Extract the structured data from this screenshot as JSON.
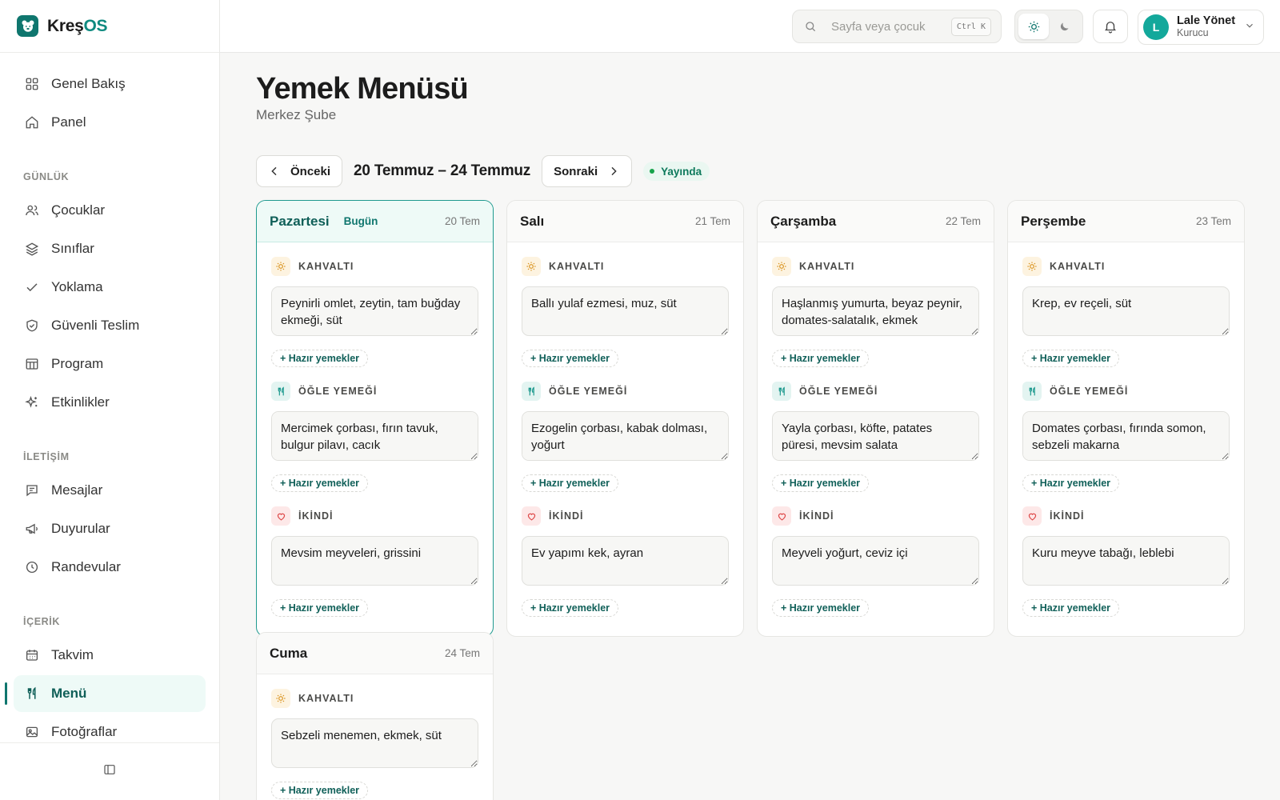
{
  "brand": {
    "name_part1": "Kreş",
    "name_part2": "OS"
  },
  "sidebar": {
    "top": [
      {
        "label": "Genel Bakış",
        "icon": "grid-icon"
      },
      {
        "label": "Panel",
        "icon": "home-icon"
      }
    ],
    "sections": [
      {
        "title": "GÜNLÜK",
        "items": [
          {
            "label": "Çocuklar",
            "icon": "users-icon"
          },
          {
            "label": "Sınıflar",
            "icon": "layers-icon"
          },
          {
            "label": "Yoklama",
            "icon": "check-icon"
          },
          {
            "label": "Güvenli Teslim",
            "icon": "shield-check-icon"
          },
          {
            "label": "Program",
            "icon": "table-icon"
          },
          {
            "label": "Etkinlikler",
            "icon": "sparkle-icon"
          }
        ]
      },
      {
        "title": "İLETİŞİM",
        "items": [
          {
            "label": "Mesajlar",
            "icon": "message-icon"
          },
          {
            "label": "Duyurular",
            "icon": "megaphone-icon"
          },
          {
            "label": "Randevular",
            "icon": "clock-icon"
          }
        ]
      },
      {
        "title": "İÇERİK",
        "items": [
          {
            "label": "Takvim",
            "icon": "calendar-icon"
          },
          {
            "label": "Menü",
            "icon": "fork-knife-icon",
            "active": true
          },
          {
            "label": "Fotoğraflar",
            "icon": "image-icon"
          }
        ]
      }
    ]
  },
  "topbar": {
    "search_placeholder": "Sayfa veya çocuk",
    "search_shortcut": "Ctrl K",
    "user_initial": "L",
    "user_name": "Lale Yönet",
    "user_role": "Kurucu"
  },
  "page": {
    "title": "Yemek Menüsü",
    "subtitle": "Merkez Şube",
    "prev_label": "Önceki",
    "next_label": "Sonraki",
    "week_range": "20 Temmuz – 24 Temmuz",
    "status": "Yayında"
  },
  "meal_labels": {
    "breakfast": "KAHVALTI",
    "lunch": "ÖĞLE YEMEĞİ",
    "snack": "İKİNDİ"
  },
  "preset_label": "+ Hazır yemekler",
  "today_label": "Bugün",
  "days": [
    {
      "name": "Pazartesi",
      "date": "20 Tem",
      "today": true,
      "breakfast": "Peynirli omlet, zeytin, tam buğday ekmeği, süt",
      "lunch": "Mercimek çorbası, fırın tavuk, bulgur pilavı, cacık",
      "snack": "Mevsim meyveleri, grissini"
    },
    {
      "name": "Salı",
      "date": "21 Tem",
      "breakfast": "Ballı yulaf ezmesi, muz, süt",
      "lunch": "Ezogelin çorbası, kabak dolması, yoğurt",
      "snack": "Ev yapımı kek, ayran"
    },
    {
      "name": "Çarşamba",
      "date": "22 Tem",
      "breakfast": "Haşlanmış yumurta, beyaz peynir, domates-salatalık, ekmek",
      "lunch": "Yayla çorbası, köfte, patates püresi, mevsim salata",
      "snack": "Meyveli yoğurt, ceviz içi"
    },
    {
      "name": "Perşembe",
      "date": "23 Tem",
      "breakfast": "Krep, ev reçeli, süt",
      "lunch": "Domates çorbası, fırında somon, sebzeli makarna",
      "snack": "Kuru meyve tabağı, leblebi"
    },
    {
      "name": "Cuma",
      "date": "24 Tem",
      "breakfast": "Sebzeli menemen, ekmek, süt"
    }
  ]
}
